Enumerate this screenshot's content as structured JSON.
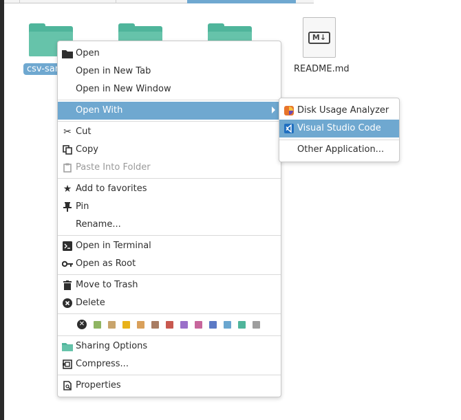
{
  "files": [
    {
      "name": "csv-sam",
      "selected": true
    },
    {
      "name": "",
      "selected": false
    },
    {
      "name": "",
      "selected": false
    },
    {
      "name": "README.md",
      "selected": false
    }
  ],
  "readme_badge": "M↓",
  "context_menu": {
    "open": "Open",
    "open_new_tab": "Open in New Tab",
    "open_new_window": "Open in New Window",
    "open_with": "Open With",
    "cut": "Cut",
    "copy": "Copy",
    "paste_into_folder": "Paste Into Folder",
    "add_to_favorites": "Add to favorites",
    "pin": "Pin",
    "rename": "Rename...",
    "open_in_terminal": "Open in Terminal",
    "open_as_root": "Open as Root",
    "move_to_trash": "Move to Trash",
    "delete": "Delete",
    "sharing_options": "Sharing Options",
    "compress": "Compress...",
    "properties": "Properties"
  },
  "color_tags": [
    "#8fb562",
    "#c8a46c",
    "#e8b21a",
    "#d9a05a",
    "#a87c62",
    "#c8584f",
    "#9a6fc9",
    "#c7669c",
    "#5b79c5",
    "#6aa6cf",
    "#4fb59b",
    "#9e9e9e"
  ],
  "submenu": {
    "disk_usage_analyzer": "Disk Usage Analyzer",
    "visual_studio_code": "Visual Studio Code",
    "other_application": "Other Application..."
  },
  "colors": {
    "highlight": "#6fa8d0",
    "folder": "#4fb59b"
  }
}
